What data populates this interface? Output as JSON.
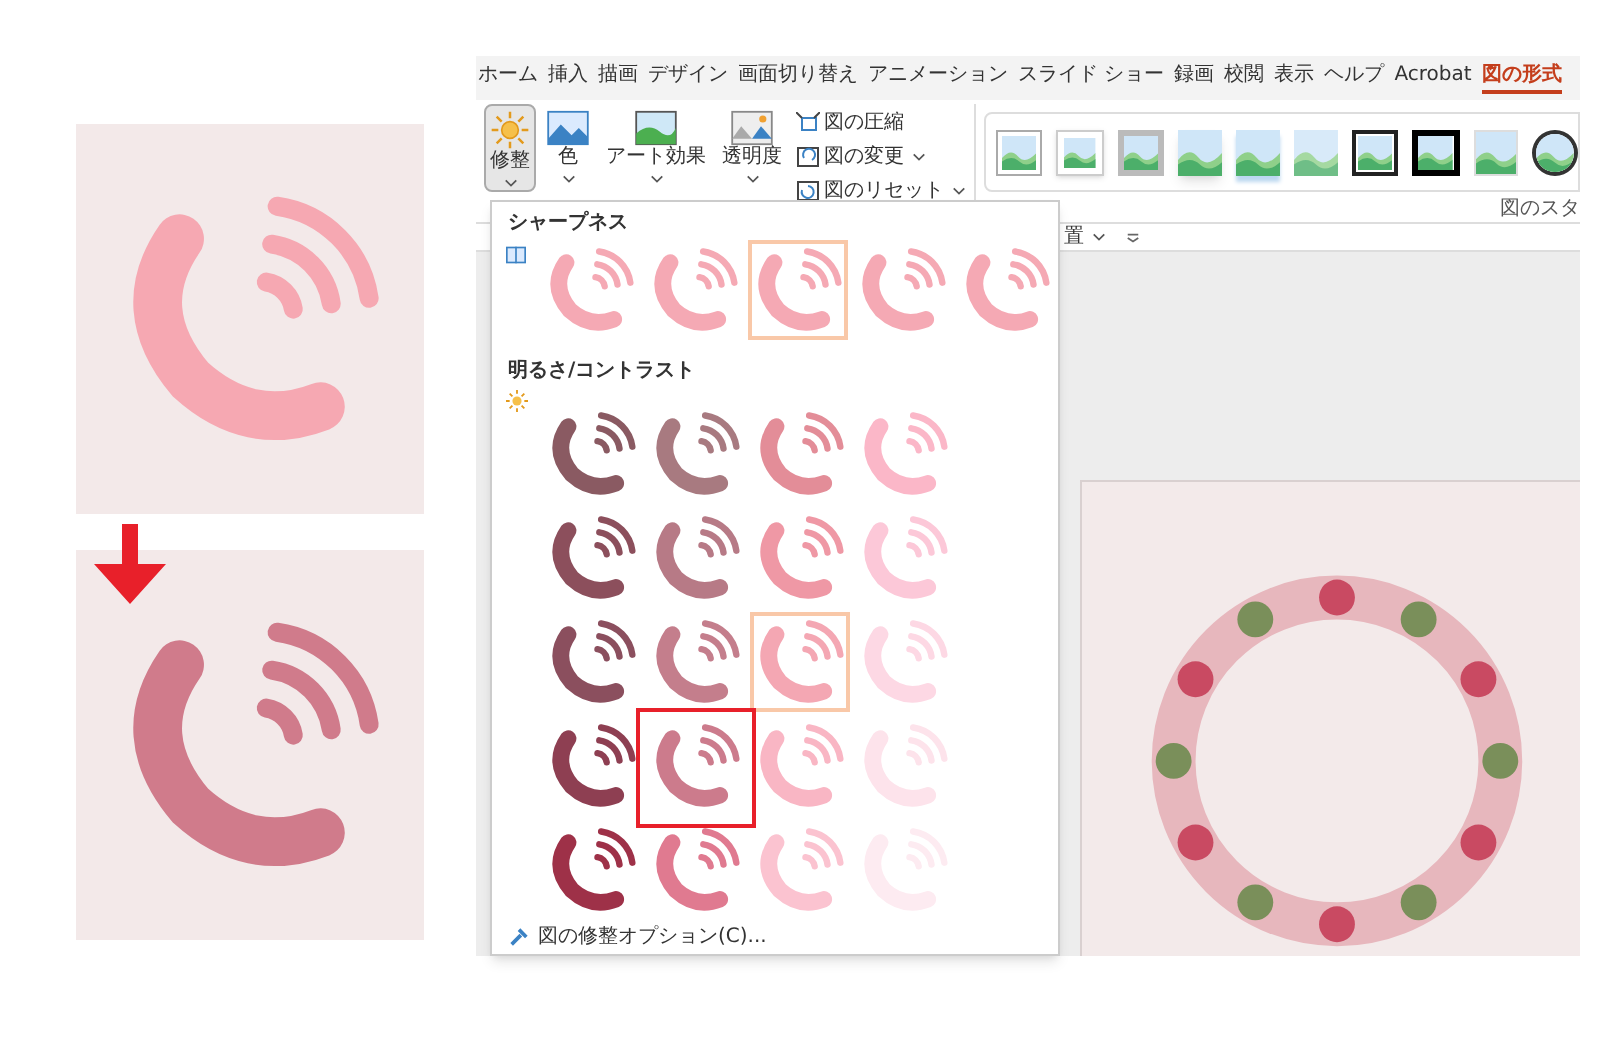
{
  "comparison": {
    "samples": [
      {
        "color": "#f6a8b2"
      },
      {
        "color": "#d07b8b"
      }
    ]
  },
  "app": {
    "tabs": [
      {
        "label": "ホーム",
        "selected": false
      },
      {
        "label": "挿入",
        "selected": false
      },
      {
        "label": "描画",
        "selected": false
      },
      {
        "label": "デザイン",
        "selected": false
      },
      {
        "label": "画面切り替え",
        "selected": false
      },
      {
        "label": "アニメーション",
        "selected": false
      },
      {
        "label": "スライド ショー",
        "selected": false
      },
      {
        "label": "録画",
        "selected": false
      },
      {
        "label": "校閲",
        "selected": false
      },
      {
        "label": "表示",
        "selected": false
      },
      {
        "label": "ヘルプ",
        "selected": false
      },
      {
        "label": "Acrobat",
        "selected": false
      },
      {
        "label": "図の形式",
        "selected": true
      }
    ],
    "ribbon": {
      "large_buttons": [
        {
          "kind": "sun",
          "label": "修整",
          "selected": true
        },
        {
          "kind": "color",
          "label": "色",
          "selected": false
        },
        {
          "kind": "art",
          "label": "アート効果",
          "selected": false
        },
        {
          "kind": "transparency",
          "label": "透明度",
          "selected": false
        }
      ],
      "small_buttons": [
        {
          "kind": "compress",
          "label": "図の圧縮",
          "dropdown": false
        },
        {
          "kind": "change",
          "label": "図の変更",
          "dropdown": true
        },
        {
          "kind": "reset",
          "label": "図のリセット",
          "dropdown": true
        }
      ],
      "picture_styles": [
        {
          "kind": "frame"
        },
        {
          "kind": "white-frame"
        },
        {
          "kind": "gray-frame"
        },
        {
          "kind": "shadow"
        },
        {
          "kind": "reflection"
        },
        {
          "kind": "soft"
        },
        {
          "kind": "black-frame"
        },
        {
          "kind": "thick-frame"
        },
        {
          "kind": "plain"
        },
        {
          "kind": "oval"
        }
      ],
      "group_label": "図のスタ",
      "arrange_label": "置"
    },
    "corrections_menu": {
      "sharpness": {
        "title": "シャープネス",
        "items": [
          {
            "color": "#f5a9b4",
            "selected": false
          },
          {
            "color": "#f5a9b4",
            "selected": false
          },
          {
            "color": "#f5a9b4",
            "selected": true
          },
          {
            "color": "#f5a9b4",
            "selected": false
          },
          {
            "color": "#f5a9b4",
            "selected": false
          }
        ]
      },
      "brightness_contrast": {
        "title": "明るさ/コントラスト",
        "items": [
          {
            "color": "#8a5a62",
            "selected": false,
            "highlighted": false
          },
          {
            "color": "#a87a80",
            "selected": false,
            "highlighted": false
          },
          {
            "color": "#e38d98",
            "selected": false,
            "highlighted": false
          },
          {
            "color": "#fbb7c8",
            "selected": false,
            "highlighted": false
          },
          {
            "color": "#8c4f5c",
            "selected": false,
            "highlighted": false
          },
          {
            "color": "#b77a86",
            "selected": false,
            "highlighted": false
          },
          {
            "color": "#ef98a5",
            "selected": false,
            "highlighted": false
          },
          {
            "color": "#fcc8d8",
            "selected": false,
            "highlighted": false
          },
          {
            "color": "#8b4f5e",
            "selected": false,
            "highlighted": false
          },
          {
            "color": "#c47e8c",
            "selected": false,
            "highlighted": false
          },
          {
            "color": "#f4a7b3",
            "selected": true,
            "highlighted": false
          },
          {
            "color": "#fdd8e4",
            "selected": false,
            "highlighted": false
          },
          {
            "color": "#8e3f52",
            "selected": false,
            "highlighted": false
          },
          {
            "color": "#cc7b8c",
            "selected": false,
            "highlighted": true
          },
          {
            "color": "#f9b6c4",
            "selected": false,
            "highlighted": false
          },
          {
            "color": "#fde3eb",
            "selected": false,
            "highlighted": false
          },
          {
            "color": "#9e3148",
            "selected": false,
            "highlighted": false
          },
          {
            "color": "#e07a90",
            "selected": false,
            "highlighted": false
          },
          {
            "color": "#fbc3d0",
            "selected": false,
            "highlighted": false
          },
          {
            "color": "#fdebf1",
            "selected": false,
            "highlighted": false
          }
        ]
      },
      "options_link": "図の修整オプション(C)..."
    }
  }
}
